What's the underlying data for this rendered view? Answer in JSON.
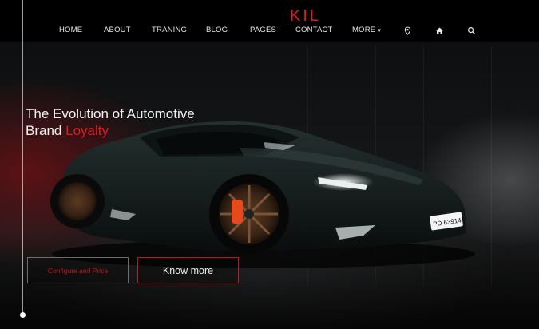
{
  "brand": {
    "logo_text": "KIL",
    "accent_color": "#e11b22"
  },
  "nav": {
    "items": [
      {
        "label": "HOME"
      },
      {
        "label": "ABOUT"
      },
      {
        "label": "TRANING"
      },
      {
        "label": "BLOG"
      },
      {
        "label": "PAGES"
      },
      {
        "label": "CONTACT"
      },
      {
        "label": "MORE",
        "has_dropdown": true
      }
    ],
    "icons": [
      "map-pin-icon",
      "home-icon",
      "search-icon"
    ]
  },
  "hero": {
    "headline_line1": "The Evolution of Automotive",
    "headline_line2_plain": "Brand",
    "headline_line2_accent": "Loyalty",
    "license_plate": "PD 63914",
    "buttons": {
      "configure_label": "Configure and Price",
      "know_more_label": "Know more"
    }
  }
}
